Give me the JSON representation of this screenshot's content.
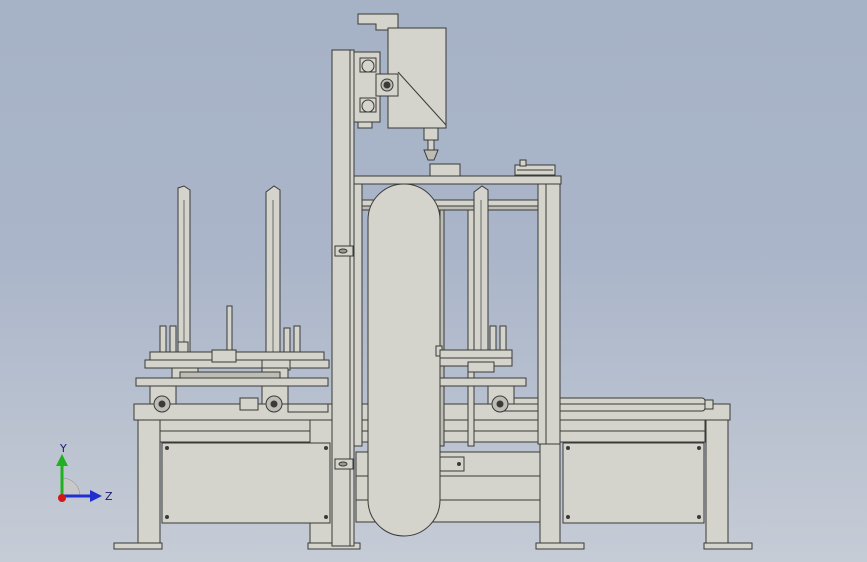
{
  "triad": {
    "y_label": "Y",
    "z_label": "Z"
  },
  "colors": {
    "background_top": "#a6b2c6",
    "background_bottom": "#c6ccd6",
    "machine_fill": "#d4d4cc",
    "machine_dark": "#bdbdb5",
    "edge": "#3a3a38",
    "y_axis": "#20b020",
    "z_axis": "#2030d0",
    "x_axis": "#d01818"
  }
}
